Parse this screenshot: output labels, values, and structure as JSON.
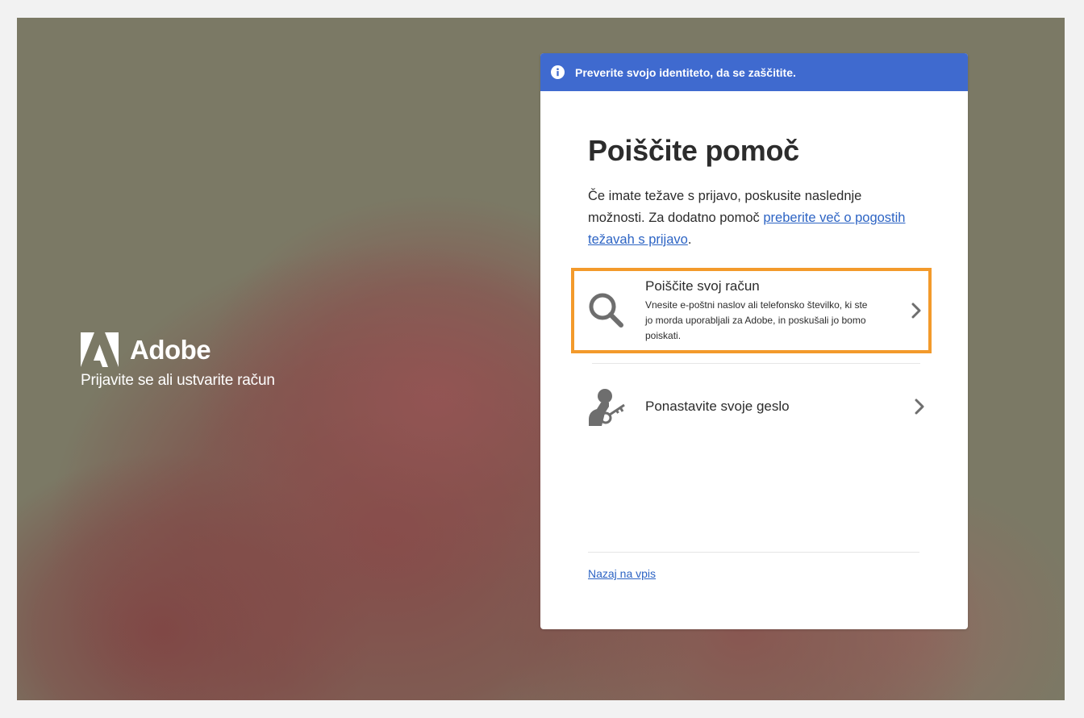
{
  "brand": {
    "name": "Adobe",
    "tagline": "Prijavite se ali ustvarite račun"
  },
  "banner": {
    "text": "Preverite svojo identiteto, da se zaščitite.",
    "color": "#3f6acf"
  },
  "page": {
    "title": "Poiščite pomoč",
    "intro_text": "Če imate težave s prijavo, poskusite naslednje možnosti. Za dodatno pomoč ",
    "intro_link": "preberite več o pogostih težavah s prijavo",
    "intro_end": "."
  },
  "options": [
    {
      "title": "Poiščite svoj račun",
      "description": "Vnesite e-poštni naslov ali telefonsko številko, ki ste jo morda uporabljali za Adobe, in poskušali jo bomo poiskati.",
      "icon": "search-icon",
      "highlight_color": "#f39a2b"
    },
    {
      "title": "Ponastavite svoje geslo",
      "icon": "user-key-icon"
    }
  ],
  "footer": {
    "back_link": "Nazaj na vpis"
  },
  "colors": {
    "link": "#2d64c4",
    "text": "#2c2c2c"
  }
}
